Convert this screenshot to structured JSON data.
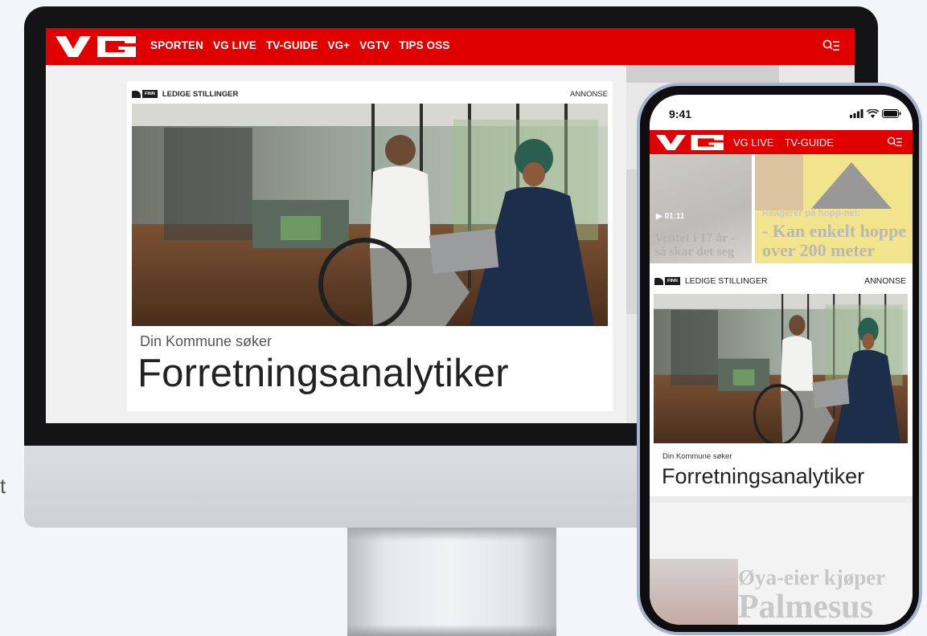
{
  "desktop": {
    "nav": [
      "SPORTEN",
      "VG LIVE",
      "TV-GUIDE",
      "VG+",
      "VGTV",
      "TIPS OSS"
    ],
    "ad": {
      "finn_logo": "FINN",
      "label": "LEDIGE STILLINGER",
      "annonse": "ANNONSE",
      "subtitle": "Din Kommune søker",
      "title": "Forretningsanalytiker"
    }
  },
  "phone": {
    "time": "9:41",
    "nav": [
      "VG LIVE",
      "TV-GUIDE"
    ],
    "teaser_a": {
      "badge": "▶ 01:11",
      "title_line1": "Ventet i 17 år -",
      "title_line2": "så skar det seg"
    },
    "teaser_b": {
      "kicker": "Reagerer på hopp-nei:",
      "title_line1": "- Kan enkelt hoppe",
      "title_line2": "over 200 meter"
    },
    "ad": {
      "finn_logo": "FINN",
      "label": "LEDIGE STILLINGER",
      "annonse": "ANNONSE",
      "subtitle": "Din Kommune søker",
      "title": "Forretningsanalytiker"
    },
    "bottom": {
      "title_line1": "Øya-eier kjøper",
      "title_line2": "Palmesus"
    }
  },
  "colors": {
    "vg_red": "#e00000",
    "ink": "#222222"
  },
  "icons": [
    "vg-logo",
    "search-menu-icon",
    "signal-icon",
    "wifi-icon",
    "battery-icon",
    "play-icon"
  ]
}
